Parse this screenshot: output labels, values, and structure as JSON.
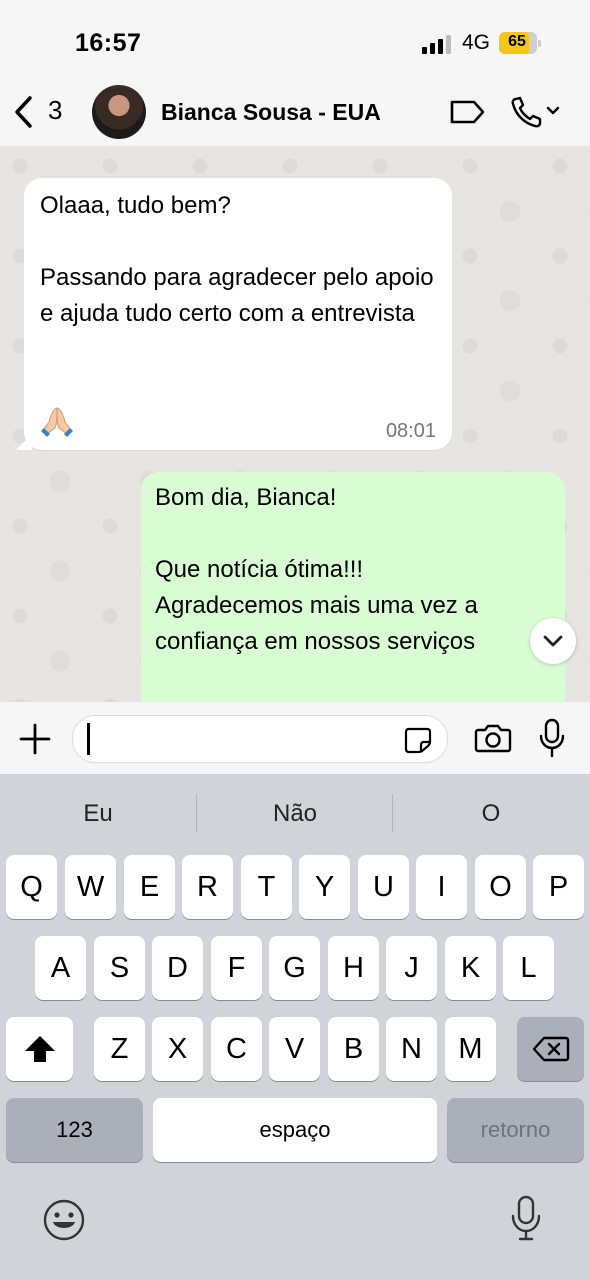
{
  "status_bar": {
    "time": "16:57",
    "network": "4G",
    "battery": "65",
    "battery_color": "#f5c518"
  },
  "header": {
    "back_count": "3",
    "contact_name": "Bianca Sousa - EUA"
  },
  "messages": [
    {
      "direction": "incoming",
      "text": "Olaaa, tudo bem?\n\nPassando para agradecer pelo apoio e ajuda tudo certo com a entrevista",
      "emoji": "folded-hands",
      "time": "08:01"
    },
    {
      "direction": "outgoing",
      "text": "Bom dia, Bianca!\n\nQue notícia ótima!!!\nAgradecemos mais uma vez a confiança em nossos serviços"
    }
  ],
  "composer": {
    "value": ""
  },
  "keyboard": {
    "suggestions": [
      "Eu",
      "Não",
      "O"
    ],
    "row1": [
      "Q",
      "W",
      "E",
      "R",
      "T",
      "Y",
      "U",
      "I",
      "O",
      "P"
    ],
    "row2": [
      "A",
      "S",
      "D",
      "F",
      "G",
      "H",
      "J",
      "K",
      "L"
    ],
    "row3": [
      "Z",
      "X",
      "C",
      "V",
      "B",
      "N",
      "M"
    ],
    "numbers_label": "123",
    "space_label": "espaço",
    "return_label": "retorno"
  },
  "colors": {
    "outgoing_bubble": "#d9fdd3",
    "incoming_bubble": "#ffffff",
    "keyboard_bg": "#d1d3d9"
  }
}
